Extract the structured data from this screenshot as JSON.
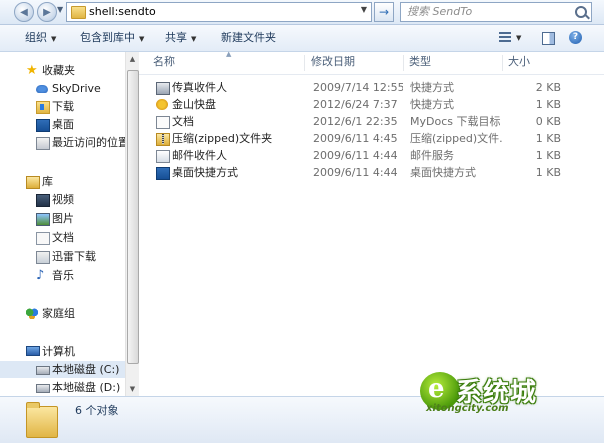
{
  "address": {
    "path": "shell:sendto",
    "search_placeholder": "搜索 SendTo",
    "go_arrow": "→"
  },
  "toolbar": {
    "organize": "组织",
    "include_library": "包含到库中",
    "share": "共享",
    "new_folder": "新建文件夹"
  },
  "nav": {
    "favorites": {
      "label": "收藏夹",
      "items": [
        "SkyDrive",
        "下载",
        "桌面",
        "最近访问的位置"
      ]
    },
    "libraries": {
      "label": "库",
      "items": [
        "视频",
        "图片",
        "文档",
        "迅雷下载",
        "音乐"
      ]
    },
    "homegroup": "家庭组",
    "computer": {
      "label": "计算机",
      "items": [
        "本地磁盘 (C:)",
        "本地磁盘 (D:)"
      ]
    }
  },
  "columns": {
    "name": "名称",
    "date": "修改日期",
    "type": "类型",
    "size": "大小"
  },
  "files": [
    {
      "icon": "fax-icon",
      "name": "传真收件人",
      "date": "2009/7/14 12:55",
      "type": "快捷方式",
      "size": "2 KB"
    },
    {
      "icon": "kingsoft-disk-icon",
      "name": "金山快盘",
      "date": "2012/6/24 7:37",
      "type": "快捷方式",
      "size": "1 KB"
    },
    {
      "icon": "document-icon",
      "name": "文档",
      "date": "2012/6/1 22:35",
      "type": "MyDocs 下载目标",
      "size": "0 KB"
    },
    {
      "icon": "zip-folder-icon",
      "name": "压缩(zipped)文件夹",
      "date": "2009/6/11 4:45",
      "type": "压缩(zipped)文件...",
      "size": "1 KB"
    },
    {
      "icon": "mail-icon",
      "name": "邮件收件人",
      "date": "2009/6/11 4:44",
      "type": "邮件服务",
      "size": "1 KB"
    },
    {
      "icon": "desktop-shortcut-icon",
      "name": "桌面快捷方式",
      "date": "2009/6/11 4:44",
      "type": "桌面快捷方式",
      "size": "1 KB"
    }
  ],
  "status": {
    "count_text": "6 个对象"
  },
  "watermark": {
    "brand": "系统城",
    "url": "xitongcity.com"
  }
}
